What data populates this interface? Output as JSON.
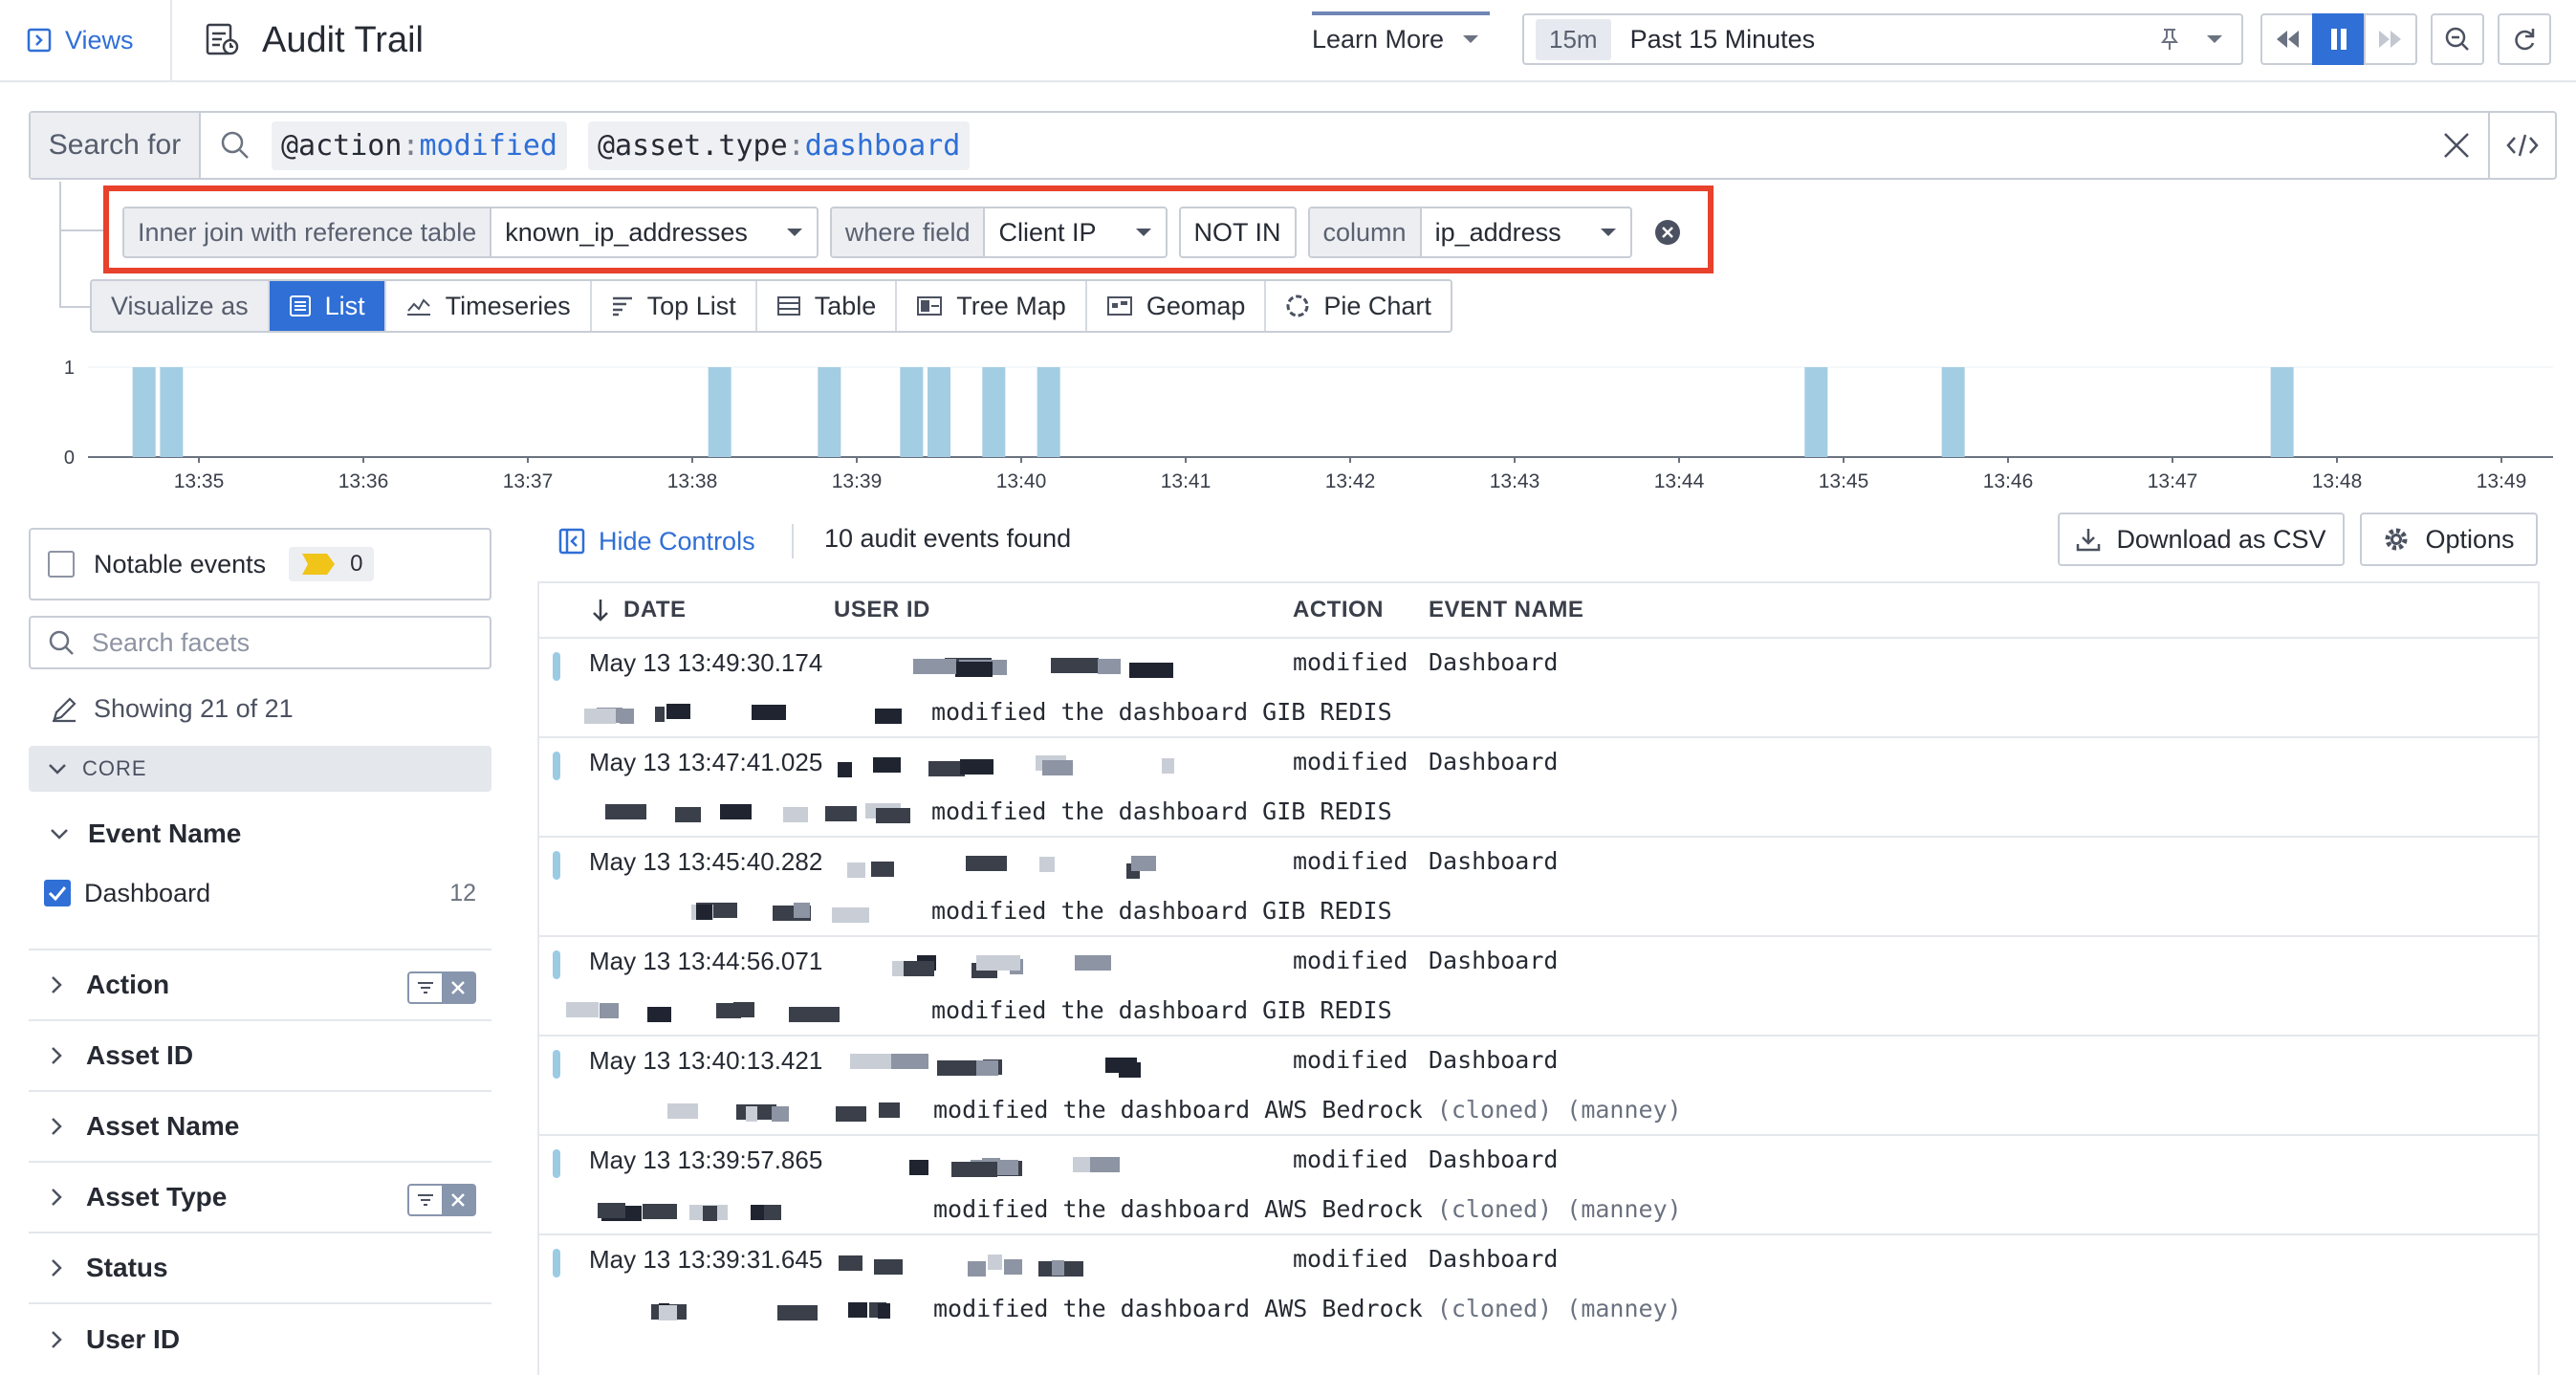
{
  "topbar": {
    "views_label": "Views",
    "title": "Audit Trail",
    "learn_more": "Learn More",
    "time_badge": "15m",
    "time_label": "Past 15 Minutes"
  },
  "search": {
    "label": "Search for",
    "chips": [
      {
        "key": "@action",
        "value": "modified"
      },
      {
        "key": "@asset.type",
        "value": "dashboard"
      }
    ]
  },
  "join": {
    "inner_join_label": "Inner join with reference table",
    "table_value": "known_ip_addresses",
    "where_label": "where field",
    "field_value": "Client IP",
    "operator": "NOT IN",
    "column_label": "column",
    "column_value": "ip_address"
  },
  "visualize": {
    "label": "Visualize as",
    "options": [
      "List",
      "Timeseries",
      "Top List",
      "Table",
      "Tree Map",
      "Geomap",
      "Pie Chart"
    ],
    "active": "List"
  },
  "chart_data": {
    "type": "bar",
    "y_ticks": [
      "1",
      "0"
    ],
    "ylim": [
      0,
      1
    ],
    "x_ticks": [
      "13:35",
      "13:36",
      "13:37",
      "13:38",
      "13:39",
      "13:40",
      "13:41",
      "13:42",
      "13:43",
      "13:44",
      "13:45",
      "13:46",
      "13:47",
      "13:48",
      "13:49"
    ],
    "bars_at": [
      "13:34:40",
      "13:34:50",
      "13:38:10",
      "13:38:50",
      "13:39:20",
      "13:39:30",
      "13:39:50",
      "13:40:10",
      "13:44:50",
      "13:45:40",
      "13:47:40"
    ],
    "values": [
      1,
      1,
      1,
      1,
      1,
      1,
      1,
      1,
      1,
      1,
      1
    ],
    "bar_color": "#a3cde3"
  },
  "left": {
    "notable_label": "Notable events",
    "notable_count": "0",
    "search_placeholder": "Search facets",
    "showing": "Showing 21 of 21",
    "core_label": "CORE",
    "event_name_label": "Event Name",
    "dashboard_label": "Dashboard",
    "dashboard_count": "12",
    "facets": [
      "Action",
      "Asset ID",
      "Asset Name",
      "Asset Type",
      "Status",
      "User ID"
    ]
  },
  "results": {
    "hide_controls": "Hide Controls",
    "count_text": "10 audit events found",
    "download": "Download as CSV",
    "options": "Options",
    "columns": {
      "date": "DATE",
      "user": "USER ID",
      "action": "ACTION",
      "event": "EVENT NAME"
    },
    "rows": [
      {
        "date": "May 13 13:49:30.174",
        "action": "modified",
        "event": "Dashboard",
        "message": "modified the dashboard GIB REDIS",
        "suffix": ""
      },
      {
        "date": "May 13 13:47:41.025",
        "action": "modified",
        "event": "Dashboard",
        "message": "modified the dashboard GIB REDIS",
        "suffix": ""
      },
      {
        "date": "May 13 13:45:40.282",
        "action": "modified",
        "event": "Dashboard",
        "message": "modified the dashboard GIB REDIS",
        "suffix": ""
      },
      {
        "date": "May 13 13:44:56.071",
        "action": "modified",
        "event": "Dashboard",
        "message": "modified the dashboard GIB REDIS",
        "suffix": ""
      },
      {
        "date": "May 13 13:40:13.421",
        "action": "modified",
        "event": "Dashboard",
        "message": "modified the dashboard AWS Bedrock",
        "suffix": "(cloned) (manney)"
      },
      {
        "date": "May 13 13:39:57.865",
        "action": "modified",
        "event": "Dashboard",
        "message": "modified the dashboard AWS Bedrock",
        "suffix": "(cloned) (manney)"
      },
      {
        "date": "May 13 13:39:31.645",
        "action": "modified",
        "event": "Dashboard",
        "message": "modified the dashboard AWS Bedrock",
        "suffix": "(cloned) (manney)"
      }
    ]
  },
  "colors": {
    "accent": "#2f6fd6",
    "highlight_border": "#e8412c",
    "bar": "#a3cde3"
  }
}
